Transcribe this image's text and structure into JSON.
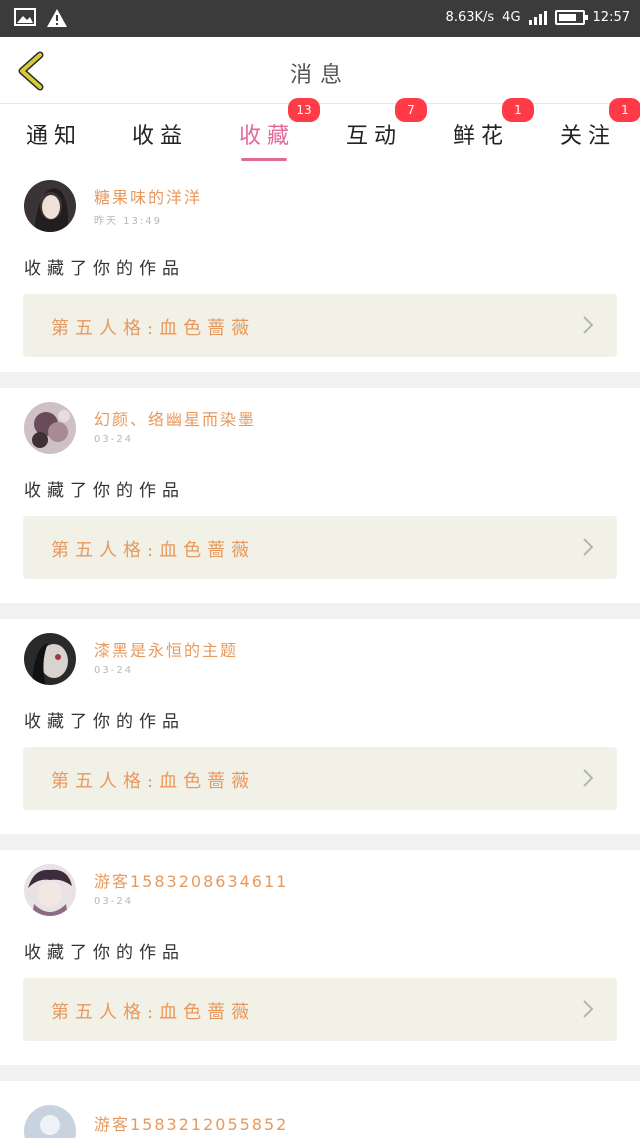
{
  "status_bar": {
    "speed": "8.63K/s",
    "network": "4G",
    "battery_level": 0.8,
    "time": "12:57"
  },
  "header": {
    "title": "消息",
    "back_icon": "chevron-left-icon"
  },
  "tabs": [
    {
      "label": "通知",
      "active": false,
      "badge": ""
    },
    {
      "label": "收益",
      "active": false,
      "badge": ""
    },
    {
      "label": "收藏",
      "active": true,
      "badge": "13"
    },
    {
      "label": "互动",
      "active": false,
      "badge": "7"
    },
    {
      "label": "鲜花",
      "active": false,
      "badge": "1"
    },
    {
      "label": "关注",
      "active": false,
      "badge": "1"
    }
  ],
  "feed": [
    {
      "username": "糖果味的洋洋",
      "time": "昨天 13:49",
      "action": "收藏了你的作品",
      "work_title": "第五人格:血色蔷薇"
    },
    {
      "username": "幻颜、络幽星而染墨",
      "time": "03-24",
      "action": "收藏了你的作品",
      "work_title": "第五人格:血色蔷薇"
    },
    {
      "username": "漆黑是永恒的主题",
      "time": "03-24",
      "action": "收藏了你的作品",
      "work_title": "第五人格:血色蔷薇"
    },
    {
      "username": "游客1583208634611",
      "time": "03-24",
      "action": "收藏了你的作品",
      "work_title": "第五人格:血色蔷薇"
    },
    {
      "username": "游客1583212055852",
      "time": "",
      "action": "",
      "work_title": ""
    }
  ],
  "colors": {
    "accent": "#e06a99",
    "username": "#e8995d",
    "badge": "#ff3b47",
    "work_box_bg": "#f1f1e7",
    "back_arrow": "#c9bb2e"
  }
}
